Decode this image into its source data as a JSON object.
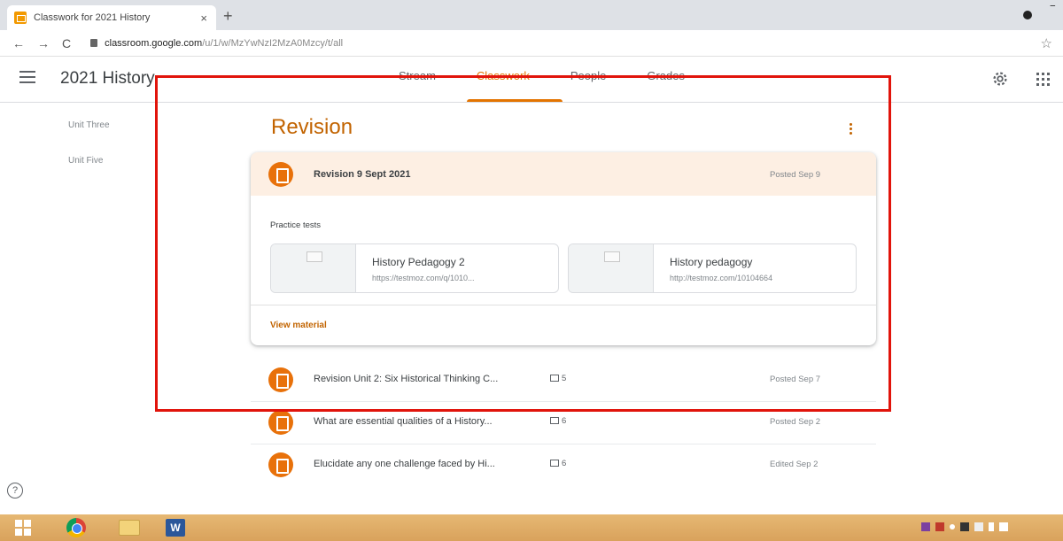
{
  "browser": {
    "tab_title": "Classwork for 2021 History",
    "tab_close": "×",
    "new_tab": "+",
    "url_host": "classroom.google.com",
    "url_path": "/u/1/w/MzYwNzI2MzA0Mzcy/t/all"
  },
  "header": {
    "class_name": "2021 History",
    "tabs": [
      "Stream",
      "Classwork",
      "People",
      "Grades"
    ]
  },
  "sidebar": {
    "topics": [
      "Unit Three",
      "Unit Five"
    ]
  },
  "topic": {
    "title": "Revision",
    "expanded_item": {
      "title": "Revision 9 Sept 2021",
      "date": "Posted Sep 9",
      "section_label": "Practice tests",
      "materials": [
        {
          "title": "History Pedagogy 2",
          "url": "https://testmoz.com/q/1010..."
        },
        {
          "title": "History pedagogy",
          "url": "http://testmoz.com/10104664"
        }
      ],
      "view_link": "View material"
    },
    "items": [
      {
        "title": "Revision Unit 2: Six Historical Thinking C...",
        "comments": "5",
        "date": "Posted Sep 7"
      },
      {
        "title": "What are essential qualities of a History...",
        "comments": "6",
        "date": "Posted Sep 2"
      },
      {
        "title": "Elucidate any one challenge faced by Hi...",
        "comments": "6",
        "date": "Edited Sep 2"
      }
    ]
  },
  "help": "?",
  "taskbar": {
    "word_label": "W"
  },
  "colors": {
    "accent": "#e37400",
    "highlight_bg": "#fdefe3",
    "annotation_box": "#e1140b"
  }
}
